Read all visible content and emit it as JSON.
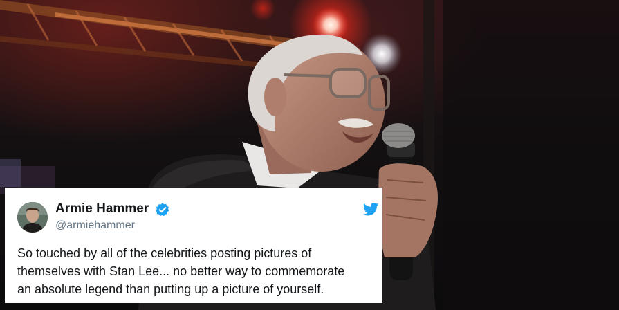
{
  "tweet": {
    "author_name": "Armie Hammer",
    "handle": "@armiehammer",
    "lines": [
      "So touched by all of the celebrities posting pictures of",
      "themselves with Stan Lee... no better way to commemorate",
      "an absolute legend than putting up a picture of yourself."
    ]
  },
  "icons": {
    "verified": "verified-badge-icon",
    "twitter": "twitter-bird-icon"
  },
  "colors": {
    "verified_blue": "#1da1f2",
    "twitter_blue": "#1da1f2",
    "handle_gray": "#657786",
    "text_dark": "#14171a"
  }
}
